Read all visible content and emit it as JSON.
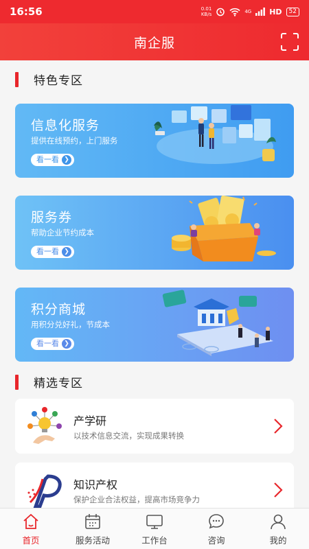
{
  "status_bar": {
    "time": "16:56",
    "net_speed_value": "0.01",
    "net_speed_unit": "KB/s",
    "signal_label": "4G",
    "hd_label": "HD",
    "battery": "52"
  },
  "header": {
    "title": "南企服",
    "scan_icon": "scan-icon"
  },
  "featured_section": {
    "title": "特色专区",
    "banners": [
      {
        "title": "信息化服务",
        "subtitle": "提供在线预约，上门服务",
        "button": "看一看"
      },
      {
        "title": "服务券",
        "subtitle": "帮助企业节约成本",
        "button": "看一看"
      },
      {
        "title": "积分商城",
        "subtitle": "用积分兑好礼，节成本",
        "button": "看一看"
      }
    ]
  },
  "selected_section": {
    "title": "精选专区",
    "items": [
      {
        "title": "产学研",
        "subtitle": "以技术信息交流，实现成果转换",
        "icon": "lightbulb-icon"
      },
      {
        "title": "知识产权",
        "subtitle": "保护企业合法权益，提高市场竞争力",
        "icon": "ip-logo-icon"
      }
    ]
  },
  "tab_bar": {
    "active_index": 0,
    "tabs": [
      {
        "label": "首页",
        "icon": "home-icon"
      },
      {
        "label": "服务活动",
        "icon": "calendar-icon"
      },
      {
        "label": "工作台",
        "icon": "monitor-icon"
      },
      {
        "label": "咨询",
        "icon": "chat-icon"
      },
      {
        "label": "我的",
        "icon": "user-icon"
      }
    ]
  },
  "colors": {
    "brand_red": "#e8262b",
    "header_red": "#ee2a2f",
    "banner_blue": "#3f9cf1"
  }
}
